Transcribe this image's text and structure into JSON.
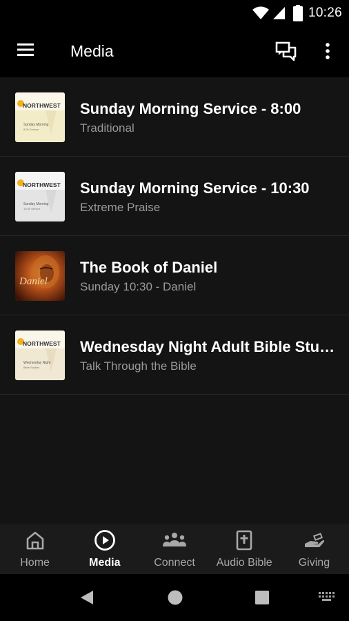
{
  "status_bar": {
    "time": "10:26",
    "icons": [
      "wifi-icon",
      "cell-signal-icon",
      "battery-icon"
    ]
  },
  "app_bar": {
    "title": "Media",
    "icons": [
      "menu-icon",
      "chat-icon",
      "more-vert-icon"
    ]
  },
  "media_items": [
    {
      "title": "Sunday Morning Service - 8:00",
      "subtitle": "Traditional",
      "thumb": {
        "brand": "NORTHWEST",
        "line1": "Sunday Morning",
        "line2": "8:00 Service",
        "bg": "#f3ecc8"
      }
    },
    {
      "title": "Sunday Morning Service - 10:30",
      "subtitle": "Extreme Praise",
      "thumb": {
        "brand": "NORTHWEST",
        "line1": "Sunday Morning",
        "line2": "10:30 Service",
        "bg": "#e4e4e4"
      }
    },
    {
      "title": "The Book of Daniel",
      "subtitle": "Sunday 10:30 - Daniel",
      "thumb": {
        "script": "Daniel",
        "bg": "#a4460e"
      }
    },
    {
      "title": "Wednesday Night Adult Bible Stu…",
      "subtitle": "Talk Through the Bible",
      "thumb": {
        "brand": "NORTHWEST",
        "line1": "Wednesday Night",
        "line2": "Bible Studies",
        "bg": "#f1e8d4"
      }
    }
  ],
  "bottom_nav": [
    {
      "label": "Home",
      "icon": "home-icon",
      "active": false
    },
    {
      "label": "Media",
      "icon": "play-circle-icon",
      "active": true
    },
    {
      "label": "Connect",
      "icon": "people-icon",
      "active": false
    },
    {
      "label": "Audio Bible",
      "icon": "bible-icon",
      "active": false
    },
    {
      "label": "Giving",
      "icon": "giving-hand-icon",
      "active": false
    }
  ],
  "system_nav": [
    "back-icon",
    "home-circle-icon",
    "recents-icon",
    "keyboard-icon"
  ],
  "colors": {
    "background": "#141414",
    "app_bar": "#000000",
    "bottom_nav": "#1b1b1b",
    "subtitle": "#9a9a9a",
    "divider": "#262626"
  }
}
